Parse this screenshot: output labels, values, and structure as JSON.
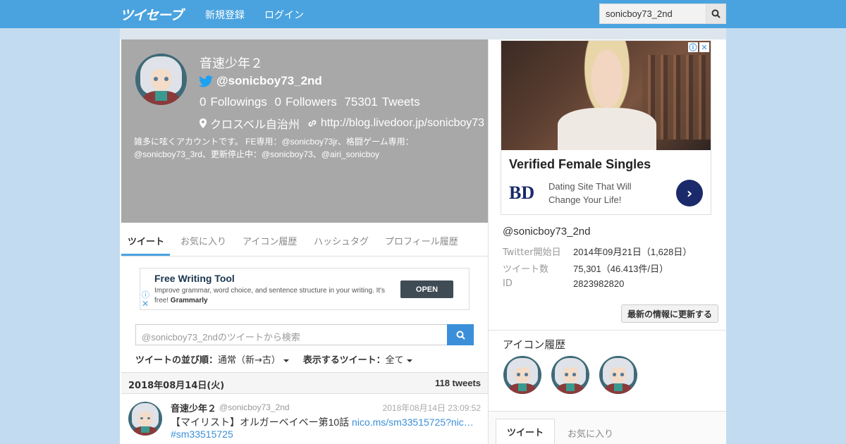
{
  "navbar": {
    "logo": "ツイセーブ",
    "register": "新規登録",
    "login": "ログイン",
    "search_value": "sonicboy73_2nd"
  },
  "profile": {
    "name": "音速少年２",
    "handle": "@sonicboy73_2nd",
    "followings_count": "0",
    "followings_label": "Followings",
    "followers_count": "0",
    "followers_label": "Followers",
    "tweets_count": "75301",
    "tweets_label": "Tweets",
    "location": "クロスベル自治州",
    "url": "http://blog.livedoor.jp/sonicboy73",
    "bio": "雑多に呟くアカウントです。 FE専用：@sonicboy73jr、格闘ゲーム専用：@sonicboy73_3rd、更新停止中：@sonicboy73、@airi_sonicboy"
  },
  "tabs": [
    "ツイート",
    "お気に入り",
    "アイコン履歴",
    "ハッシュタグ",
    "プロフィール履歴"
  ],
  "ad": {
    "title": "Free Writing Tool",
    "desc": "Improve grammar, word choice, and sentence structure in your writing. It's free!",
    "brand": "Grammarly",
    "cta": "OPEN"
  },
  "tweet_search": {
    "placeholder": "@sonicboy73_2ndのツイートから検索"
  },
  "sort": {
    "order_label": "ツイートの並び順：",
    "order_value": "通常（新→古）",
    "filter_label": "表示するツイート：",
    "filter_value": "全て"
  },
  "date_bar": {
    "date": "2018年08月14日(火)",
    "count": "118 tweets"
  },
  "tweet": {
    "name": "音速少年２",
    "handle": "@sonicboy73_2nd",
    "time": "2018年08月14日 23:09:52",
    "text": "【マイリスト】オルガーベイベー第10話 ",
    "link": "nico.ms/sm33515725?nic…",
    "hashtag": "#sm33515725"
  },
  "sponsor": {
    "title": "Verified Female Singles",
    "logo": "BD",
    "desc": "Dating Site That Will Change Your Life!"
  },
  "info": {
    "handle": "@sonicboy73_2nd",
    "start_label": "Twitter開始日",
    "start_value": "2014年09月21日（1,628日）",
    "tweets_label": "ツイート数",
    "tweets_value": "75,301（46.413件/日）",
    "id_label": "ID",
    "id_value": "2823982820",
    "refresh": "最新の情報に更新する"
  },
  "icon_history": {
    "title": "アイコン履歴"
  },
  "right_tabs": [
    "ツイート",
    "お気に入り"
  ],
  "colors": {
    "navbar": "#4aa3df",
    "accent": "#3b8fd9",
    "profile_header": "#a8a8a8"
  }
}
